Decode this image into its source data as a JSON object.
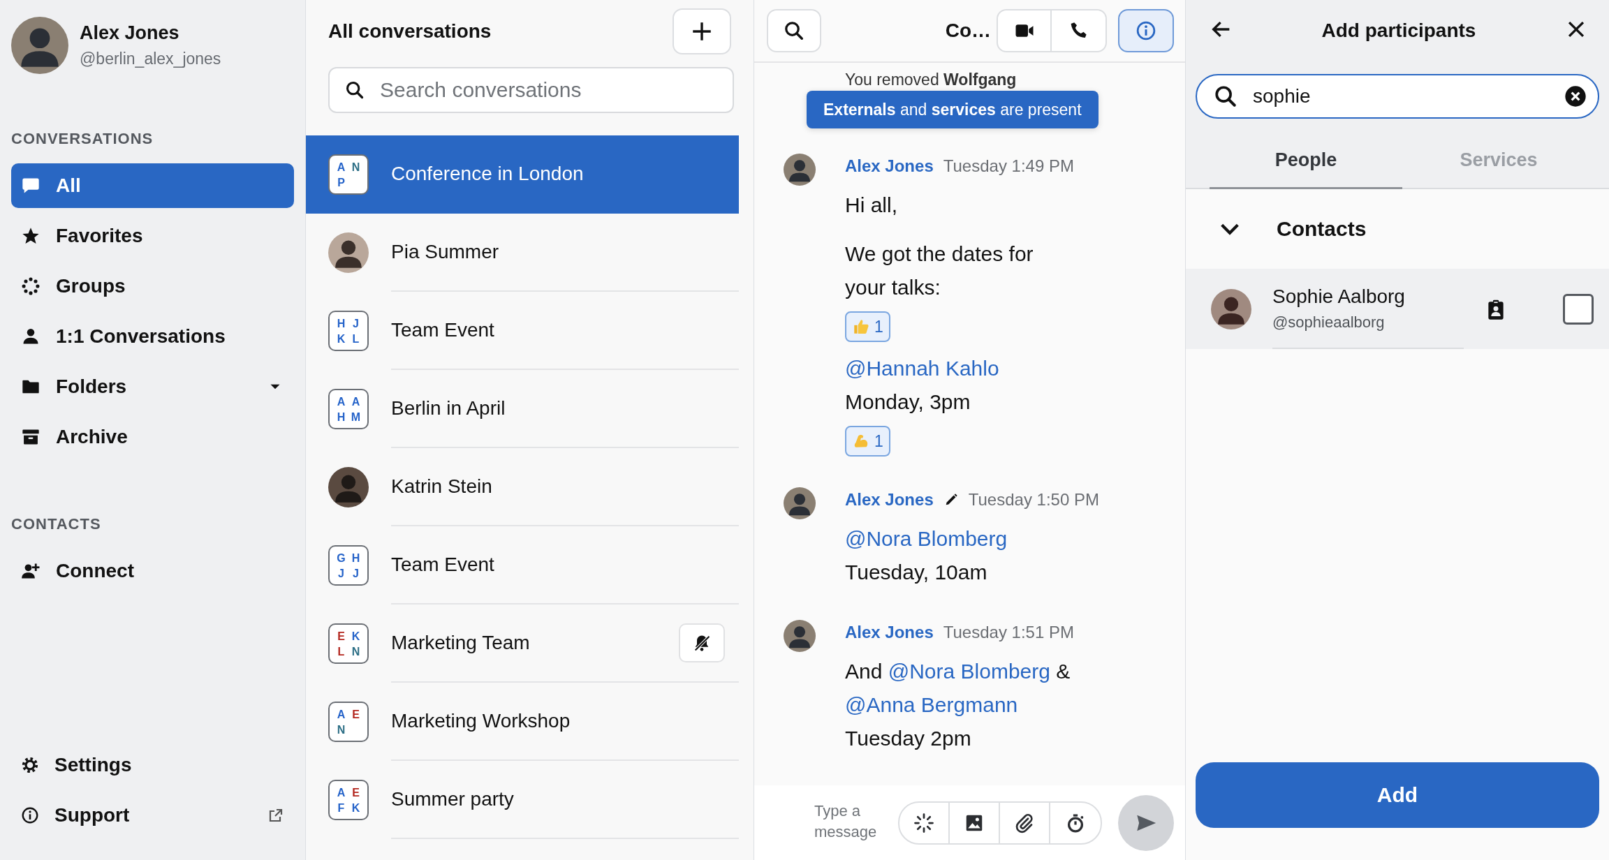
{
  "sidebar": {
    "user": {
      "name": "Alex Jones",
      "handle": "@berlin_alex_jones"
    },
    "sections": [
      {
        "title": "CONVERSATIONS",
        "items": [
          {
            "label": "All",
            "selected": true,
            "dropdown": false
          },
          {
            "label": "Favorites",
            "selected": false,
            "dropdown": false
          },
          {
            "label": "Groups",
            "selected": false,
            "dropdown": false
          },
          {
            "label": "1:1 Conversations",
            "selected": false,
            "dropdown": false
          },
          {
            "label": "Folders",
            "selected": false,
            "dropdown": true
          },
          {
            "label": "Archive",
            "selected": false,
            "dropdown": false
          }
        ]
      },
      {
        "title": "CONTACTS",
        "items": [
          {
            "label": "Connect",
            "selected": false,
            "dropdown": false
          }
        ]
      }
    ],
    "footer": [
      {
        "label": "Settings",
        "external": false
      },
      {
        "label": "Support",
        "external": true
      }
    ]
  },
  "conversation_list": {
    "title": "All conversations",
    "search": {
      "placeholder": "Search conversations"
    },
    "conversations": [
      {
        "name": "Conference in London",
        "kind": "group",
        "selected": true,
        "muted": false,
        "initials": [
          {
            "letter": "A",
            "color": "#2563c9"
          },
          {
            "letter": "N",
            "color": "#2d6f86"
          },
          {
            "letter": "P",
            "color": "#2563c9"
          }
        ]
      },
      {
        "name": "Pia Summer",
        "kind": "person",
        "selected": false,
        "muted": false
      },
      {
        "name": "Team Event",
        "kind": "group",
        "selected": false,
        "muted": false,
        "initials": [
          {
            "letter": "H",
            "color": "#2563c9"
          },
          {
            "letter": "J",
            "color": "#2563c9"
          },
          {
            "letter": "K",
            "color": "#2563c9"
          },
          {
            "letter": "L",
            "color": "#2563c9"
          }
        ]
      },
      {
        "name": "Berlin in April",
        "kind": "group",
        "selected": false,
        "muted": false,
        "initials": [
          {
            "letter": "A",
            "color": "#2563c9"
          },
          {
            "letter": "A",
            "color": "#2563c9"
          },
          {
            "letter": "H",
            "color": "#2563c9"
          },
          {
            "letter": "M",
            "color": "#2563c9"
          }
        ]
      },
      {
        "name": "Katrin Stein",
        "kind": "person",
        "selected": false,
        "muted": false
      },
      {
        "name": "Team Event",
        "kind": "group",
        "selected": false,
        "muted": false,
        "initials": [
          {
            "letter": "G",
            "color": "#2563c9"
          },
          {
            "letter": "H",
            "color": "#2563c9"
          },
          {
            "letter": "J",
            "color": "#2563c9"
          },
          {
            "letter": "J",
            "color": "#2563c9"
          }
        ]
      },
      {
        "name": "Marketing Team",
        "kind": "group",
        "selected": false,
        "muted": true,
        "initials": [
          {
            "letter": "E",
            "color": "#b3261e"
          },
          {
            "letter": "K",
            "color": "#2563c9"
          },
          {
            "letter": "L",
            "color": "#b3261e"
          },
          {
            "letter": "N",
            "color": "#2d6f86"
          }
        ]
      },
      {
        "name": "Marketing Workshop",
        "kind": "group",
        "selected": false,
        "muted": false,
        "initials": [
          {
            "letter": "A",
            "color": "#2563c9"
          },
          {
            "letter": "E",
            "color": "#b3261e"
          },
          {
            "letter": "N",
            "color": "#2d6f86"
          }
        ]
      },
      {
        "name": "Summer party",
        "kind": "group",
        "selected": false,
        "muted": false,
        "initials": [
          {
            "letter": "A",
            "color": "#2563c9"
          },
          {
            "letter": "E",
            "color": "#b3261e"
          },
          {
            "letter": "F",
            "color": "#2563c9"
          },
          {
            "letter": "K",
            "color": "#2563c9"
          }
        ]
      }
    ]
  },
  "chat": {
    "title": "Co…",
    "actions": [
      {
        "kind": "video",
        "selected": false
      },
      {
        "kind": "call",
        "selected": false
      },
      {
        "kind": "info",
        "selected": true
      }
    ],
    "system_notice": "You removed **Wolfgang**",
    "banner": "**Externals** and **services** are present",
    "messages": [
      {
        "author": "Alex Jones",
        "edited": false,
        "time": "Tuesday 1:49 PM",
        "blocks": [
          {
            "kind": "text",
            "lines": [
              [
                {
                  "kind": "text",
                  "text": "Hi all,"
                }
              ]
            ]
          },
          {
            "kind": "text",
            "lines": [
              [
                {
                  "kind": "text",
                  "text": "We got the dates for your talks:"
                }
              ]
            ]
          },
          {
            "kind": "reaction",
            "emoji": {
              "kind": "thumbs_up"
            },
            "count": "1"
          },
          {
            "kind": "text",
            "lines": [
              [
                {
                  "kind": "mention",
                  "text": "@Hannah Kahlo"
                }
              ],
              [
                {
                  "kind": "text",
                  "text": "Monday, 3pm"
                }
              ]
            ]
          },
          {
            "kind": "reaction",
            "emoji": {
              "kind": "flexed_biceps"
            },
            "count": "1"
          }
        ]
      },
      {
        "author": "Alex Jones",
        "edited": true,
        "time": "Tuesday 1:50 PM",
        "blocks": [
          {
            "kind": "text",
            "lines": [
              [
                {
                  "kind": "mention",
                  "text": "@Nora Blomberg"
                }
              ],
              [
                {
                  "kind": "text",
                  "text": "Tuesday, 10am"
                }
              ]
            ]
          }
        ]
      },
      {
        "author": "Alex Jones",
        "edited": false,
        "time": "Tuesday 1:51 PM",
        "blocks": [
          {
            "kind": "text",
            "lines": [
              [
                {
                  "kind": "text",
                  "text": "And"
                },
                {
                  "kind": "mention",
                  "text": "@Nora Blomberg"
                },
                {
                  "kind": "text",
                  "text": "&"
                },
                {
                  "kind": "mention",
                  "text": "@Anna Bergmann"
                }
              ],
              [
                {
                  "kind": "text",
                  "text": "Tuesday 2pm"
                }
              ]
            ]
          }
        ]
      }
    ],
    "composer": {
      "placeholder": "Type a message"
    }
  },
  "participants_panel": {
    "title": "Add participants",
    "search": {
      "value": "sophie"
    },
    "tabs": [
      {
        "label": "People",
        "selected": true
      },
      {
        "label": "Services",
        "selected": false
      }
    ],
    "section": {
      "title": "Contacts",
      "expanded": true
    },
    "contacts": [
      {
        "name": "Sophie Aalborg",
        "handle": "@sophieaalborg",
        "checked": false
      }
    ],
    "add_button": "Add"
  }
}
